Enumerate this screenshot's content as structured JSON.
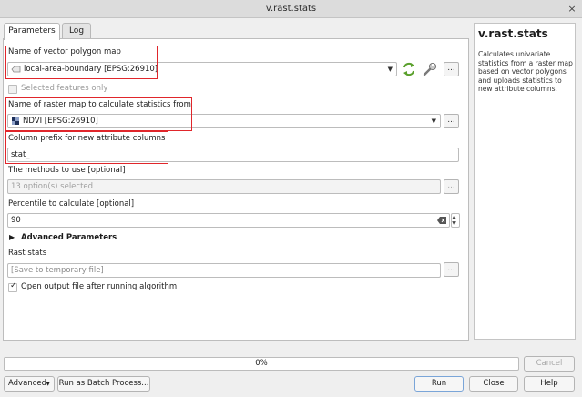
{
  "window": {
    "title": "v.rast.stats",
    "close_glyph": "×"
  },
  "tabs": [
    {
      "label": "Parameters",
      "active": true
    },
    {
      "label": "Log",
      "active": false
    }
  ],
  "params": {
    "vector_label": "Name of vector polygon map",
    "vector_value": "local-area-boundary [EPSG:26910]",
    "selected_only_label": "Selected features only",
    "raster_label": "Name of raster map to calculate statistics from",
    "raster_value": "NDVI [EPSG:26910]",
    "prefix_label": "Column prefix for new attribute columns",
    "prefix_value": "stat_",
    "methods_label": "The methods to use [optional]",
    "methods_value": "13 option(s) selected",
    "percentile_label": "Percentile to calculate [optional]",
    "percentile_value": "90",
    "advanced_label": "Advanced Parameters",
    "output_label": "Rast stats",
    "output_placeholder": "[Save to temporary file]",
    "open_output_label": "Open output file after running algorithm",
    "dots": "..."
  },
  "help": {
    "title": "v.rast.stats",
    "description": "Calculates univariate statistics from a raster map based on vector polygons and uploads statistics to new attribute columns."
  },
  "progress": {
    "text": "0%",
    "value": 0
  },
  "buttons": {
    "cancel": "Cancel",
    "advanced": "Advanced",
    "batch": "Run as Batch Process...",
    "run": "Run",
    "close": "Close",
    "help": "Help"
  },
  "colors": {
    "highlight": "#e0262b",
    "accent": "#3584e4",
    "sync_icon": "#5aa02c"
  }
}
